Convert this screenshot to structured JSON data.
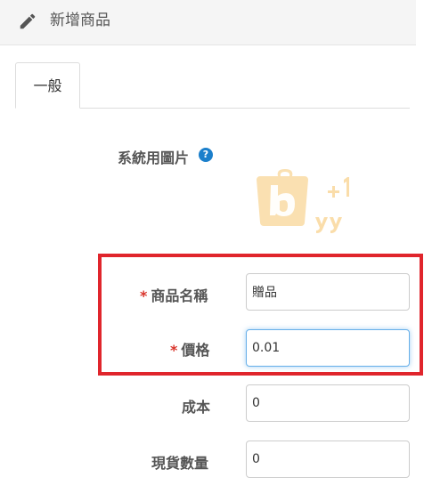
{
  "header": {
    "title": "新增商品",
    "icon": "pencil-icon"
  },
  "tabs": [
    {
      "label": "一般",
      "active": true
    }
  ],
  "form": {
    "image_label": "系統用圖片",
    "help_icon": "question-circle-icon",
    "logo_text": "buy +1",
    "fields": [
      {
        "label": "商品名稱",
        "required": true,
        "value": "贈品"
      },
      {
        "label": "價格",
        "required": true,
        "value": "0.01",
        "focused": true
      },
      {
        "label": "成本",
        "required": false,
        "value": "0"
      },
      {
        "label": "現貨數量",
        "required": false,
        "value": "0"
      }
    ],
    "required_marker": "*"
  },
  "colors": {
    "required": "#d9342b",
    "highlight": "#e0252c",
    "help_icon": "#1b7fcb",
    "logo": "#f7c873"
  }
}
